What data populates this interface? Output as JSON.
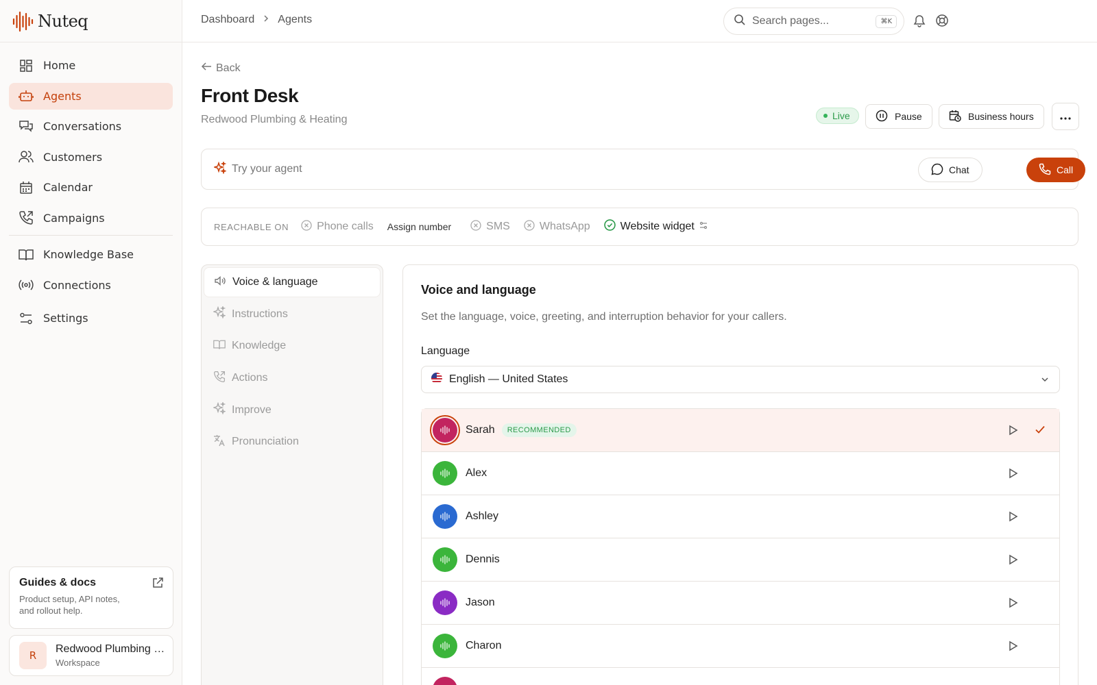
{
  "app": {
    "name": "Nuteq"
  },
  "sidebar": {
    "items": [
      {
        "label": "Home",
        "icon": "grid-icon"
      },
      {
        "label": "Agents",
        "icon": "robot-icon",
        "active": true
      },
      {
        "label": "Conversations",
        "icon": "chat-bubbles-icon"
      },
      {
        "label": "Customers",
        "icon": "users-icon"
      },
      {
        "label": "Calendar",
        "icon": "calendar-icon"
      },
      {
        "label": "Campaigns",
        "icon": "phone-outgoing-icon"
      }
    ],
    "items2": [
      {
        "label": "Knowledge Base",
        "icon": "book-icon"
      },
      {
        "label": "Connections",
        "icon": "broadcast-icon"
      }
    ],
    "settings_label": "Settings",
    "guides": {
      "title": "Guides & docs",
      "desc": "Product setup, API notes, and rollout help."
    },
    "workspace": {
      "initial": "R",
      "name": "Redwood Plumbing & Heating",
      "sub": "Workspace"
    }
  },
  "topbar": {
    "breadcrumb": [
      "Dashboard",
      "Agents"
    ],
    "search_placeholder": "Search pages...",
    "shortcut": "⌘K"
  },
  "header": {
    "back": "Back",
    "title": "Front Desk",
    "subtitle": "Redwood Plumbing & Heating",
    "status": "Live",
    "pause": "Pause",
    "business_hours": "Business hours"
  },
  "try": {
    "label": "Try your agent",
    "chat": "Chat",
    "call": "Call"
  },
  "reach": {
    "label": "REACHABLE ON",
    "phone": "Phone calls",
    "assign": "Assign number",
    "sms": "SMS",
    "whatsapp": "WhatsApp",
    "widget": "Website widget"
  },
  "settings_nav": [
    {
      "label": "Voice & language",
      "active": true
    },
    {
      "label": "Instructions"
    },
    {
      "label": "Knowledge"
    },
    {
      "label": "Actions"
    },
    {
      "label": "Improve"
    },
    {
      "label": "Pronunciation"
    }
  ],
  "voice_section": {
    "title": "Voice and language",
    "desc": "Set the language, voice, greeting, and interruption behavior for your callers.",
    "language_label": "Language",
    "language_value": "English — United States",
    "recommended": "RECOMMENDED",
    "voices": [
      {
        "name": "Sarah",
        "color": "#c2245f",
        "selected": true
      },
      {
        "name": "Alex",
        "color": "#3bb53b"
      },
      {
        "name": "Ashley",
        "color": "#2a6ad1"
      },
      {
        "name": "Dennis",
        "color": "#3bb53b"
      },
      {
        "name": "Jason",
        "color": "#8a2bc4"
      },
      {
        "name": "Charon",
        "color": "#3bb53b"
      },
      {
        "name": "",
        "color": "#c2245f"
      }
    ]
  },
  "colors": {
    "accent": "#c9410b",
    "accent_bg": "#fae4dd",
    "live": "#2c9a4a"
  }
}
